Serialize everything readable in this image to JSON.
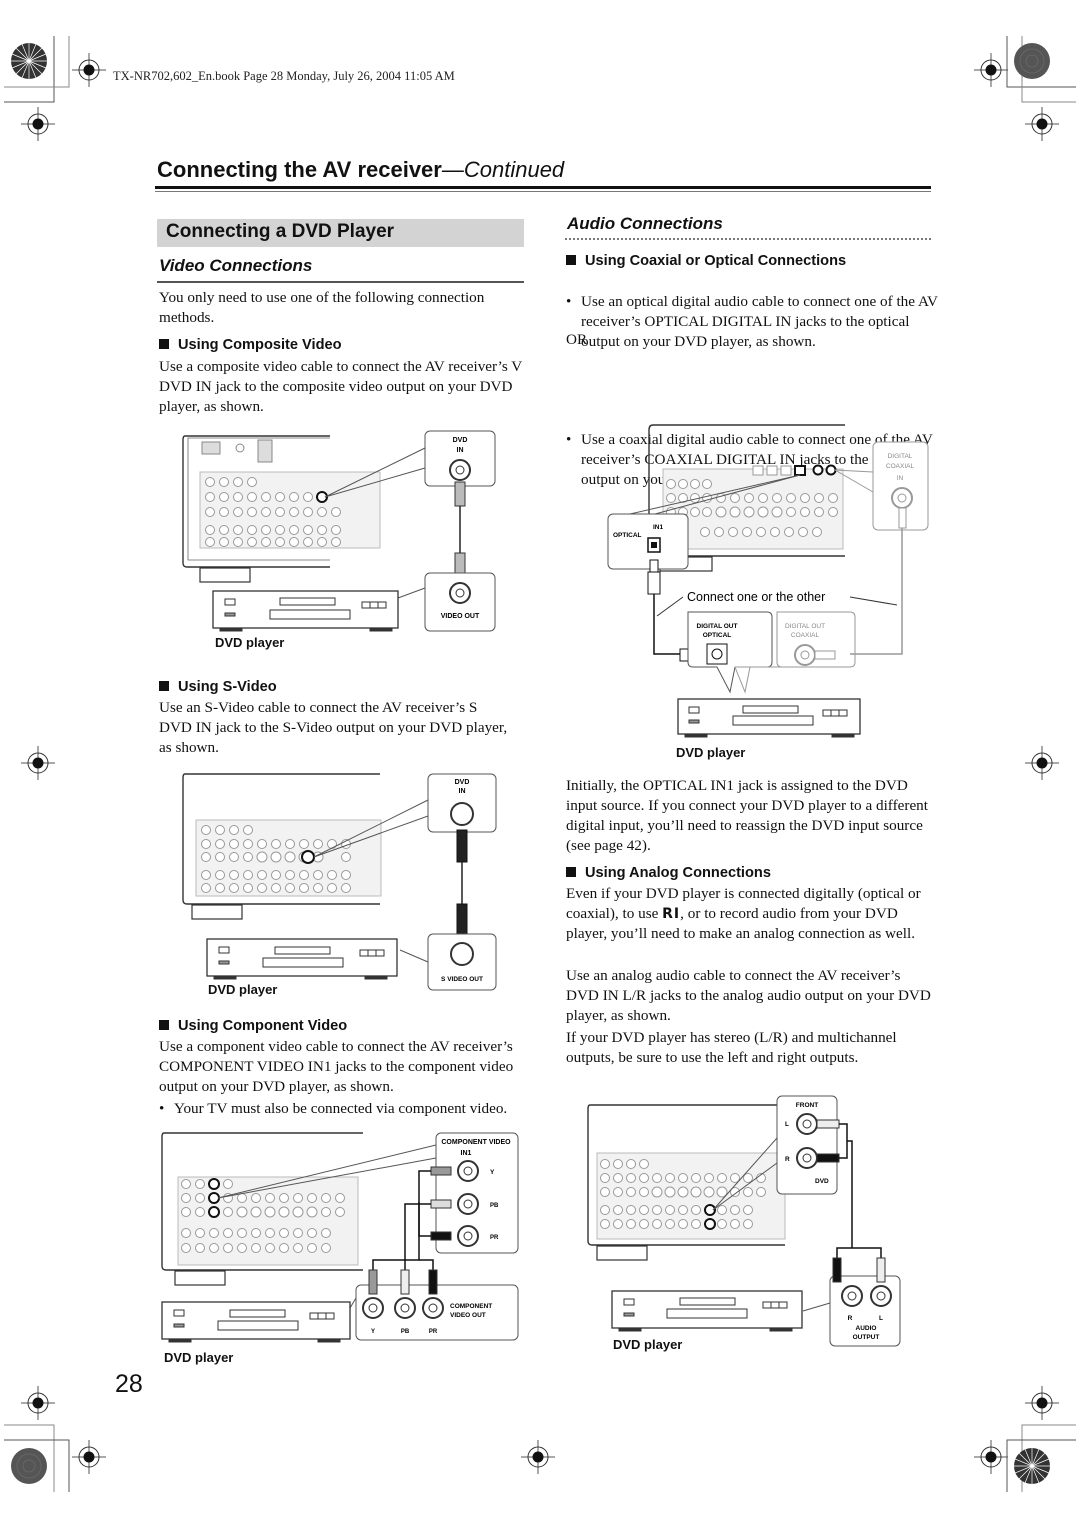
{
  "print_header": "TX-NR702,602_En.book  Page 28  Monday, July 26, 2004  11:05 AM",
  "page": {
    "title_main": "Connecting the AV receiver",
    "title_suffix": "—Continued",
    "number": "28"
  },
  "left": {
    "section_title": "Connecting a DVD Player",
    "subsection_title": "Video Connections",
    "intro": "You only need to use one of the following connection methods.",
    "composite": {
      "heading": "Using Composite Video",
      "text": "Use a composite video cable to connect the AV receiver’s V DVD IN jack to the composite video output on your DVD player, as shown.",
      "diagram": {
        "in_label_line1": "DVD",
        "in_label_line2": "IN",
        "out_label": "VIDEO OUT",
        "player_label": "DVD player"
      }
    },
    "svideo": {
      "heading": "Using S-Video",
      "text": "Use an S-Video cable to connect the AV receiver’s S DVD IN jack to the S-Video output on your DVD player, as shown.",
      "diagram": {
        "in_label_line1": "DVD",
        "in_label_line2": "IN",
        "out_label": "S VIDEO OUT",
        "player_label": "DVD player"
      }
    },
    "component": {
      "heading": "Using Component Video",
      "text": "Use a component video cable to connect the AV receiver’s COMPONENT VIDEO IN1 jacks to the component video output on your DVD player, as shown.",
      "bullet": "Your TV must also be connected via component video.",
      "diagram": {
        "in_label_line1": "COMPONENT VIDEO",
        "in_label_line2": "IN1",
        "in_jacks": [
          "Y",
          "PB",
          "PR"
        ],
        "out_label_line1": "COMPONENT",
        "out_label_line2": "VIDEO  OUT",
        "out_jacks": [
          "Y",
          "PB",
          "PR"
        ],
        "player_label": "DVD player"
      }
    }
  },
  "right": {
    "subsection_title": "Audio Connections",
    "digital": {
      "heading": "Using Coaxial or Optical Connections",
      "bullet1": "Use an optical digital audio cable to connect one of the AV receiver’s OPTICAL DIGITAL IN jacks to the optical output on your DVD player, as shown.",
      "or": "OR",
      "bullet2": "Use a coaxial digital audio cable to connect one of the AV receiver’s COAXIAL DIGITAL IN jacks to the coaxial output on your DVD player, as shown.",
      "diagram": {
        "optical_in_label": "IN1",
        "optical_label": "OPTICAL",
        "coax_in_line1": "DIGITAL",
        "coax_in_line2": "COAXIAL",
        "coax_in_line3": "IN",
        "connect_note": "Connect one or the other",
        "optical_out_line1": "DIGITAL OUT",
        "optical_out_line2": "OPTICAL",
        "coax_out_line1": "DIGITAL OUT",
        "coax_out_line2": "COAXIAL",
        "player_label": "DVD player"
      },
      "note": "Initially, the OPTICAL IN1 jack is assigned to the DVD input source. If you connect your DVD player to a different digital input, you’ll need to reassign the DVD input source (see page 42)."
    },
    "analog": {
      "heading": "Using Analog Connections",
      "text1_before": "Even if your DVD player is connected digitally (optical or coaxial), to use ",
      "ri_symbol": "RI",
      "text1_after": ", or to record audio from your DVD player, you’ll need to make an analog connection as well.",
      "text2": "Use an analog audio cable to connect the AV receiver’s DVD IN L/R jacks to the analog audio output on your DVD player, as shown.",
      "text3": "If your DVD player has stereo (L/R) and multichannel outputs, be sure to use the left and right outputs.",
      "diagram": {
        "in_label_top": "FRONT",
        "in_label_l": "L",
        "in_label_r": "R",
        "in_label_bottom": "DVD",
        "out_label_r": "R",
        "out_label_l": "L",
        "out_label_line1": "AUDIO",
        "out_label_line2": "OUTPUT",
        "player_label": "DVD player"
      }
    }
  }
}
